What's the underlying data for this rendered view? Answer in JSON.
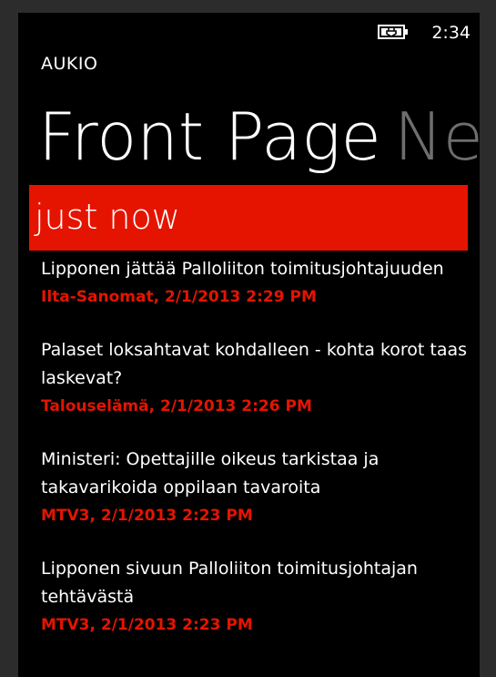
{
  "status_bar": {
    "battery_icon": "battery-charging-icon",
    "time": "2:34"
  },
  "app": {
    "title": "AUKIO"
  },
  "pivot": {
    "active": "Front Page",
    "next": "News"
  },
  "section": {
    "label": "just now"
  },
  "news": [
    {
      "title": "Lipponen jättää Palloliiton toimitusjohtajuuden",
      "meta": "Ilta-Sanomat, 2/1/2013 2:29 PM"
    },
    {
      "title": "Palaset loksahtavat kohdalleen - kohta korot taas laskevat?",
      "meta": "Talouselämä, 2/1/2013 2:26 PM"
    },
    {
      "title": "Ministeri: Opettajille oikeus tarkistaa ja takavarikoida oppilaan tavaroita",
      "meta": "MTV3, 2/1/2013 2:23 PM"
    },
    {
      "title": "Lipponen sivuun Palloliiton toimitusjohtajan tehtävästä",
      "meta": "MTV3, 2/1/2013 2:23 PM"
    }
  ],
  "colors": {
    "accent": "#e51400",
    "background": "#000000",
    "text": "#ffffff",
    "inactive_pivot": "#6e6e6e"
  }
}
